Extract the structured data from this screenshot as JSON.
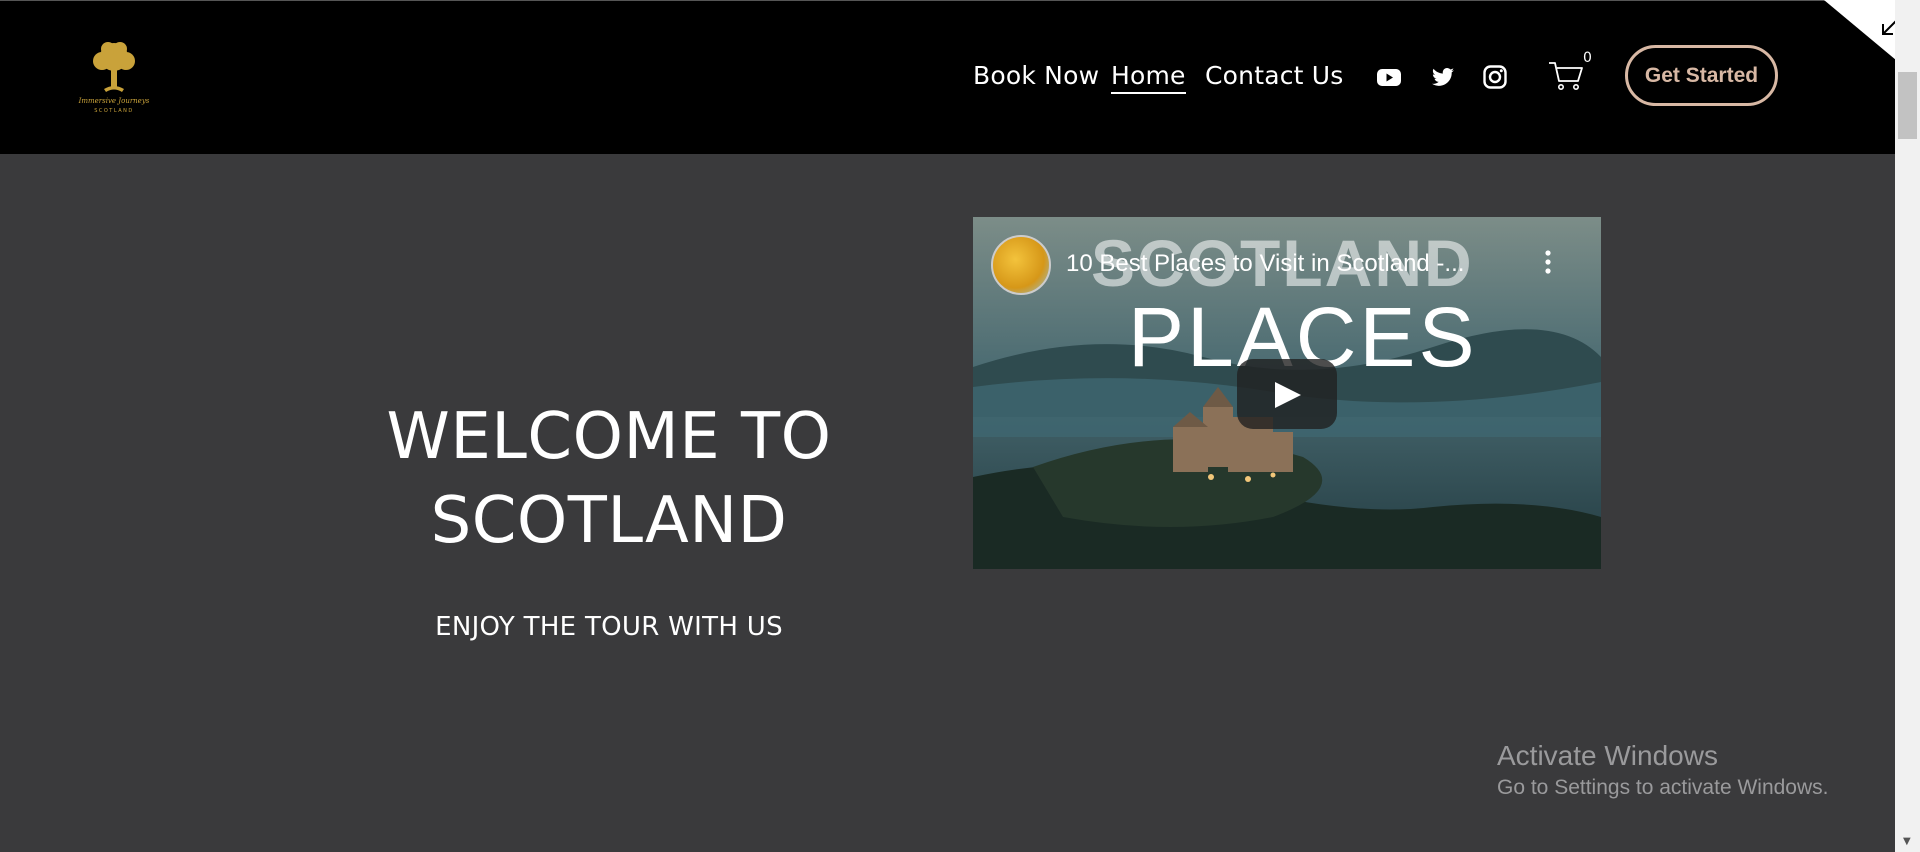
{
  "header": {
    "logo_alt": "Immersive Journeys Scotland",
    "logo_script": "Immersive Journeys",
    "logo_caption": "SCOTLAND",
    "nav": [
      {
        "label": "Book Now"
      },
      {
        "label": "Home",
        "active": true
      },
      {
        "label": "Contact Us"
      }
    ],
    "social_icons": [
      "youtube-icon",
      "twitter-icon",
      "instagram-icon"
    ],
    "cart_count": "0",
    "cta_label": "Get Started"
  },
  "hero": {
    "title": "WELCOME TO SCOTLAND",
    "subtitle": "ENJOY THE TOUR WITH US"
  },
  "video": {
    "title": "10 Best Places to Visit in Scotland -...",
    "overlay_top": "SCOTLAND",
    "overlay_bottom": "PLACES"
  },
  "watermark": {
    "title": "Activate Windows",
    "subtitle": "Go to Settings to activate Windows."
  },
  "colors": {
    "header_bg": "#000000",
    "page_bg": "#3a3a3c",
    "cta_accent": "#d8b8a4",
    "logo_gold": "#c9a23a"
  }
}
